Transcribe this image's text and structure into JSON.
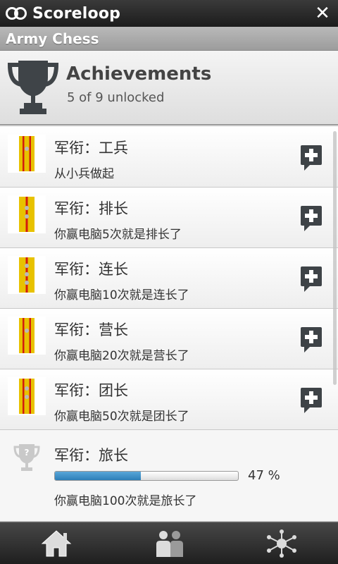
{
  "app": {
    "logo_text": "Scoreloop",
    "close_symbol": "✕"
  },
  "game": {
    "title": "Army Chess"
  },
  "header": {
    "title": "Achievements",
    "subtitle": "5 of 9 unlocked"
  },
  "colors": {
    "stripe_yellow": "#e8c200",
    "stripe_red": "#d21b0e",
    "progress_blue": "#3a8fc8"
  },
  "achievements": [
    {
      "title": "军衔：工兵",
      "desc": "从小兵做起",
      "unlocked": true,
      "icon": "rank-badge-icon"
    },
    {
      "title": "军衔：排长",
      "desc": "你赢电脑5次就是排长了",
      "unlocked": true,
      "icon": "rank-badge-icon"
    },
    {
      "title": "军衔：连长",
      "desc": "你赢电脑10次就是连长了",
      "unlocked": true,
      "icon": "rank-badge-icon"
    },
    {
      "title": "军衔：营长",
      "desc": "你赢电脑20次就是营长了",
      "unlocked": true,
      "icon": "rank-badge-icon"
    },
    {
      "title": "军衔：团长",
      "desc": "你赢电脑50次就是团长了",
      "unlocked": true,
      "icon": "rank-badge-icon"
    },
    {
      "title": "军衔：旅长",
      "desc": "你赢电脑100次就是旅长了",
      "unlocked": false,
      "progress_percent": 47,
      "progress_label": "47 %",
      "icon": "locked-trophy-icon"
    }
  ],
  "bottom_nav": [
    {
      "name": "home",
      "icon": "home-icon"
    },
    {
      "name": "friends",
      "icon": "people-icon"
    },
    {
      "name": "community",
      "icon": "network-icon"
    }
  ]
}
